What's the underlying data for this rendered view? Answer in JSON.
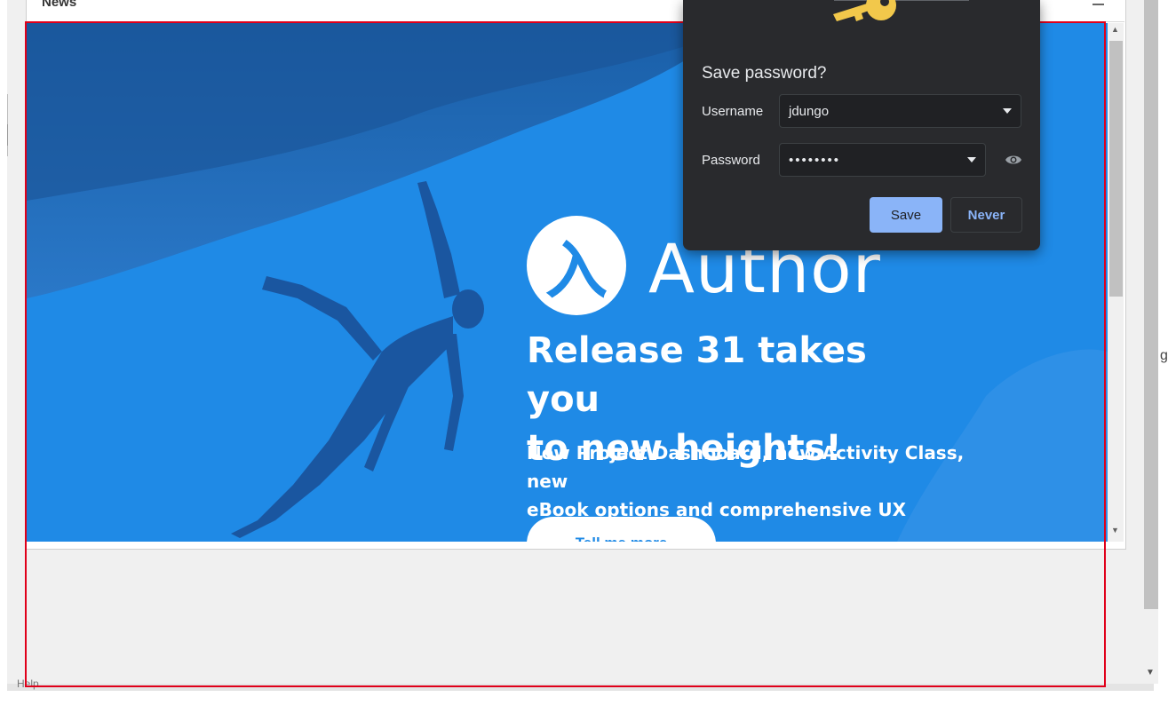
{
  "news": {
    "title": "News"
  },
  "banner": {
    "logo_glyph": "入",
    "brand": "Author",
    "headline_line1": "Release 31 takes you",
    "headline_line2": "to new heights!",
    "subhead_line1": "New Project Dashboard, new Activity Class, new",
    "subhead_line2": "eBook options and comprehensive UX streamlining.",
    "cta": "Tell me more",
    "background_color": "#1f8ae6"
  },
  "password_dialog": {
    "title": "Save password?",
    "username_label": "Username",
    "username_value": "jdungo",
    "password_label": "Password",
    "password_value": "••••••••",
    "save_label": "Save",
    "never_label": "Never",
    "icon": "key-icon",
    "accent": "#8ab4f8"
  },
  "footer": {
    "help": "Help"
  }
}
